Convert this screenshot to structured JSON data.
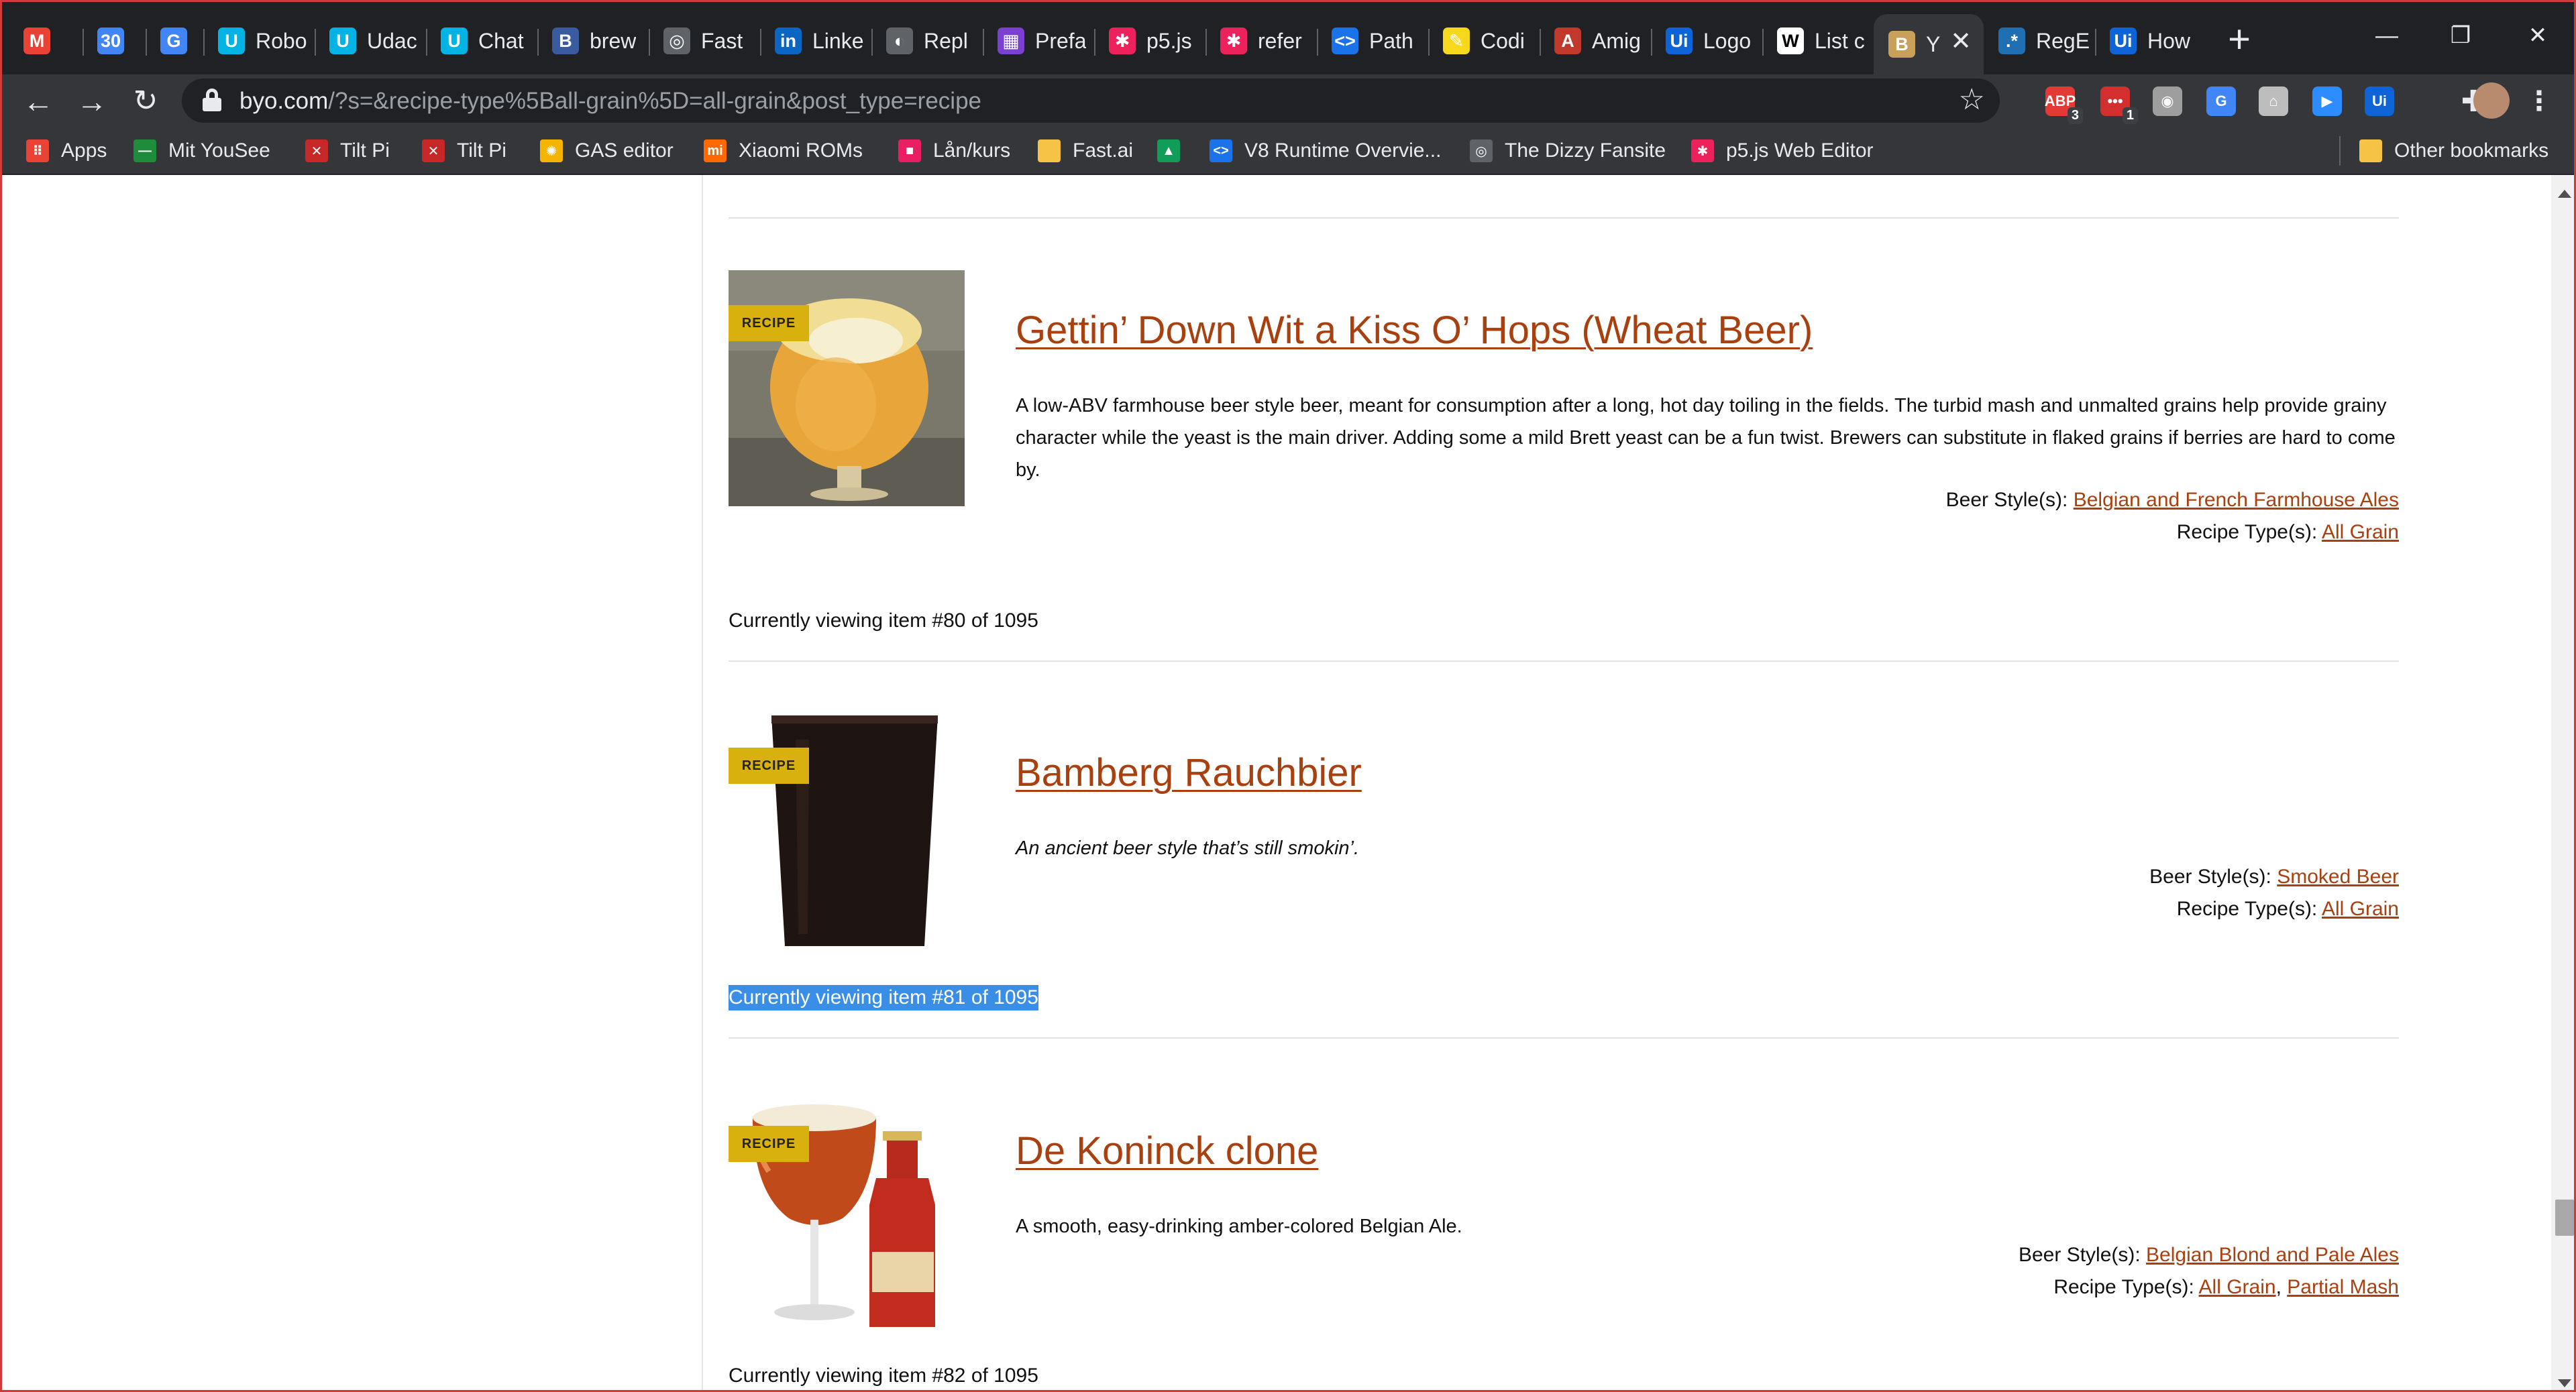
{
  "tabs": [
    {
      "title": "",
      "icon": "gmail-icon",
      "color": "#ea4335",
      "glyph": "M"
    },
    {
      "title": "",
      "icon": "calendar-icon",
      "color": "#4285f4",
      "glyph": "30"
    },
    {
      "title": "",
      "icon": "translate-icon",
      "color": "#4285f4",
      "glyph": "G"
    },
    {
      "title": "Robo",
      "icon": "udacity-icon",
      "color": "#02b3e4",
      "glyph": "U"
    },
    {
      "title": "Udac",
      "icon": "udacity-icon",
      "color": "#02b3e4",
      "glyph": "U"
    },
    {
      "title": "Chat",
      "icon": "udacity-icon",
      "color": "#02b3e4",
      "glyph": "U"
    },
    {
      "title": "brew",
      "icon": "brew-icon",
      "color": "#3a5ba0",
      "glyph": "B"
    },
    {
      "title": "Fast",
      "icon": "globe-icon",
      "color": "#5f6368",
      "glyph": "◎"
    },
    {
      "title": "Linke",
      "icon": "linkedin-icon",
      "color": "#0a66c2",
      "glyph": "in"
    },
    {
      "title": "Repl",
      "icon": "replit-icon",
      "color": "#5f6368",
      "glyph": "◐"
    },
    {
      "title": "Prefa",
      "icon": "prefab-icon",
      "color": "#7b3fd1",
      "glyph": "▦"
    },
    {
      "title": "p5.js",
      "icon": "p5js-icon",
      "color": "#ed225d",
      "glyph": "✱"
    },
    {
      "title": "refer",
      "icon": "p5js-icon",
      "color": "#ed225d",
      "glyph": "✱"
    },
    {
      "title": "Path",
      "icon": "google-dev-icon",
      "color": "#1a73e8",
      "glyph": "<>"
    },
    {
      "title": "Codi",
      "icon": "coding-icon",
      "color": "#f6d81c",
      "glyph": "✎"
    },
    {
      "title": "Amig",
      "icon": "amiga-icon",
      "color": "#c0392b",
      "glyph": "A"
    },
    {
      "title": "Logo",
      "icon": "uipath-icon",
      "color": "#0e64d6",
      "glyph": "Ui"
    },
    {
      "title": "List c",
      "icon": "wikipedia-icon",
      "color": "#ffffff",
      "glyph": "W"
    },
    {
      "title": "Y",
      "icon": "byo-icon",
      "color": "#c8a05a",
      "glyph": "B",
      "active": true
    },
    {
      "title": "RegE",
      "icon": "regex-icon",
      "color": "#1f6fb2",
      "glyph": ".*"
    },
    {
      "title": "How",
      "icon": "uipath-icon",
      "color": "#0e64d6",
      "glyph": "Ui"
    }
  ],
  "toolbar": {
    "url_host": "byo.com",
    "url_path": "/?s=&recipe-type%5Ball-grain%5D=all-grain&post_type=recipe"
  },
  "extensions": [
    {
      "name": "adblock-icon",
      "color": "#e53935",
      "glyph": "ABP",
      "badge": "3"
    },
    {
      "name": "todo-extension-icon",
      "color": "#d32f2f",
      "glyph": "•••",
      "badge": "1"
    },
    {
      "name": "film-reel-icon",
      "color": "#9e9e9e",
      "glyph": "◉"
    },
    {
      "name": "translate-extension-icon",
      "color": "#4285f4",
      "glyph": "G"
    },
    {
      "name": "tampermonkey-icon",
      "color": "#bdbdbd",
      "glyph": "⌂"
    },
    {
      "name": "zoom-icon",
      "color": "#2d8cff",
      "glyph": "▶"
    },
    {
      "name": "uipath-extension-icon",
      "color": "#0e64d6",
      "glyph": "Ui"
    },
    {
      "name": "puzzle-icon",
      "color": "#35363a",
      "glyph": "✚"
    }
  ],
  "bookmarks": [
    {
      "label": "Apps",
      "icon": "apps-grid-icon",
      "color": "#ea4335",
      "glyph": "⠿"
    },
    {
      "label": "Mit YouSee",
      "icon": "yousee-icon",
      "color": "#1e8c3a",
      "glyph": "—"
    },
    {
      "label": "Tilt Pi",
      "icon": "tilt-pi-icon",
      "color": "#c62828",
      "glyph": "✕"
    },
    {
      "label": "Tilt Pi",
      "icon": "tilt-pi-icon",
      "color": "#c62828",
      "glyph": "✕"
    },
    {
      "label": "GAS editor",
      "icon": "gas-icon",
      "color": "#f4b400",
      "glyph": "✺"
    },
    {
      "label": "Xiaomi ROMs",
      "icon": "xiaomi-icon",
      "color": "#ff6900",
      "glyph": "mi"
    },
    {
      "label": "Lån/kurs",
      "icon": "pink-square-icon",
      "color": "#e91e63",
      "glyph": "■"
    },
    {
      "label": "Fast.ai",
      "icon": "folder-icon",
      "color": "#f6c346",
      "glyph": ""
    },
    {
      "label": "",
      "icon": "google-drive-icon",
      "color": "#0f9d58",
      "glyph": "▲"
    },
    {
      "label": "V8 Runtime Overvie...",
      "icon": "google-dev-icon",
      "color": "#1a73e8",
      "glyph": "<>"
    },
    {
      "label": "The Dizzy Fansite",
      "icon": "globe-icon",
      "color": "#5f6368",
      "glyph": "◎"
    },
    {
      "label": "p5.js Web Editor",
      "icon": "p5js-icon",
      "color": "#ed225d",
      "glyph": "✱"
    }
  ],
  "other_bookmarks": "Other bookmarks",
  "results": [
    {
      "badge": "RECIPE",
      "image": "wheat-beer-glass",
      "title": "Gettin’ Down Wit a Kiss O’ Hops (Wheat Beer)",
      "description": "A low-ABV farmhouse beer style beer, meant for consumption after a long, hot day toiling in the fields. The turbid mash and unmalted grains help provide grainy character while the yeast is the main driver. Adding some a mild Brett yeast can be a fun twist. Brewers can substitute in flaked grains if berries are hard to come by.",
      "italic": false,
      "beer_style_label": "Beer Style(s): ",
      "beer_styles": [
        "Belgian and French Farmhouse Ales"
      ],
      "recipe_type_label": "Recipe Type(s): ",
      "recipe_types": [
        "All Grain"
      ],
      "status": "Currently viewing item #80 of 1095"
    },
    {
      "badge": "RECIPE",
      "image": "dark-beer-glass",
      "title": "Bamberg Rauchbier",
      "description": "An ancient beer style that’s still smokin’.",
      "italic": true,
      "beer_style_label": "Beer Style(s): ",
      "beer_styles": [
        "Smoked Beer"
      ],
      "recipe_type_label": "Recipe Type(s): ",
      "recipe_types": [
        "All Grain"
      ],
      "status": "Currently viewing item #81 of 1095"
    },
    {
      "badge": "RECIPE",
      "image": "amber-beer-bottle",
      "title": "De Koninck clone",
      "description": "A smooth, easy-drinking amber-colored Belgian Ale.",
      "italic": false,
      "beer_style_label": "Beer Style(s): ",
      "beer_styles": [
        "Belgian Blond and Pale Ales"
      ],
      "recipe_type_label": "Recipe Type(s): ",
      "recipe_types": [
        "All Grain",
        "Partial Mash"
      ],
      "status": "Currently viewing item #82 of 1095"
    }
  ],
  "colors": {
    "link": "#a8400f",
    "badge": "#d9b10f",
    "selection": "#3a8ee6"
  }
}
